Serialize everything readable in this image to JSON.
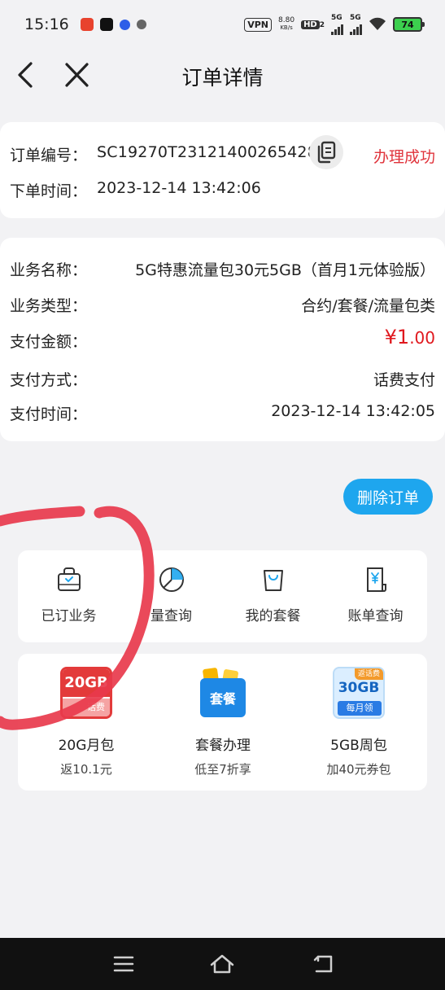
{
  "status_bar": {
    "time": "15:16",
    "vpn": "VPN",
    "speed_value": "8.80",
    "speed_unit": "KB/s",
    "hd_label": "HD",
    "hd_sub": "2",
    "net1": "5G",
    "net2": "5G",
    "battery": "74"
  },
  "header": {
    "title": "订单详情"
  },
  "order": {
    "number_label": "订单编号：",
    "number_value": "SC19270T23121400265428",
    "time_label": "下单时间：",
    "time_value": "2023-12-14 13:42:06",
    "status": "办理成功"
  },
  "details": [
    {
      "label": "业务名称：",
      "value": "5G特惠流量包30元5GB（首月1元体验版）"
    },
    {
      "label": "业务类型：",
      "value": "合约/套餐/流量包类"
    },
    {
      "label": "支付金额：",
      "value_symbol": "¥",
      "value_int": "1",
      "value_dec": ".00"
    },
    {
      "label": "支付方式：",
      "value": "话费支付"
    },
    {
      "label": "支付时间：",
      "value": "2023-12-14 13:42:05"
    }
  ],
  "delete_button": "删除订单",
  "menu": [
    {
      "label": "已订业务",
      "icon": "bag-check-icon"
    },
    {
      "label": "量查询",
      "icon": "pie-chart-icon"
    },
    {
      "label": "我的套餐",
      "icon": "shopping-bag-icon"
    },
    {
      "label": "账单查询",
      "icon": "bill-yen-icon"
    }
  ],
  "promos": [
    {
      "name": "20G月包",
      "sub": "返10.1元",
      "badge_main": "20GB",
      "badge_sub": "话费"
    },
    {
      "name": "套餐办理",
      "sub": "低至7折享",
      "badge_main": "套餐"
    },
    {
      "name": "5GB周包",
      "sub": "加40元券包",
      "badge_top": "返话费",
      "badge_main": "30GB",
      "badge_sub": "每月领"
    }
  ],
  "colors": {
    "accent_blue": "#1ea6ee",
    "success_red": "#e0343c",
    "price_red": "#e0181e",
    "circle_red": "#e83a4c"
  }
}
